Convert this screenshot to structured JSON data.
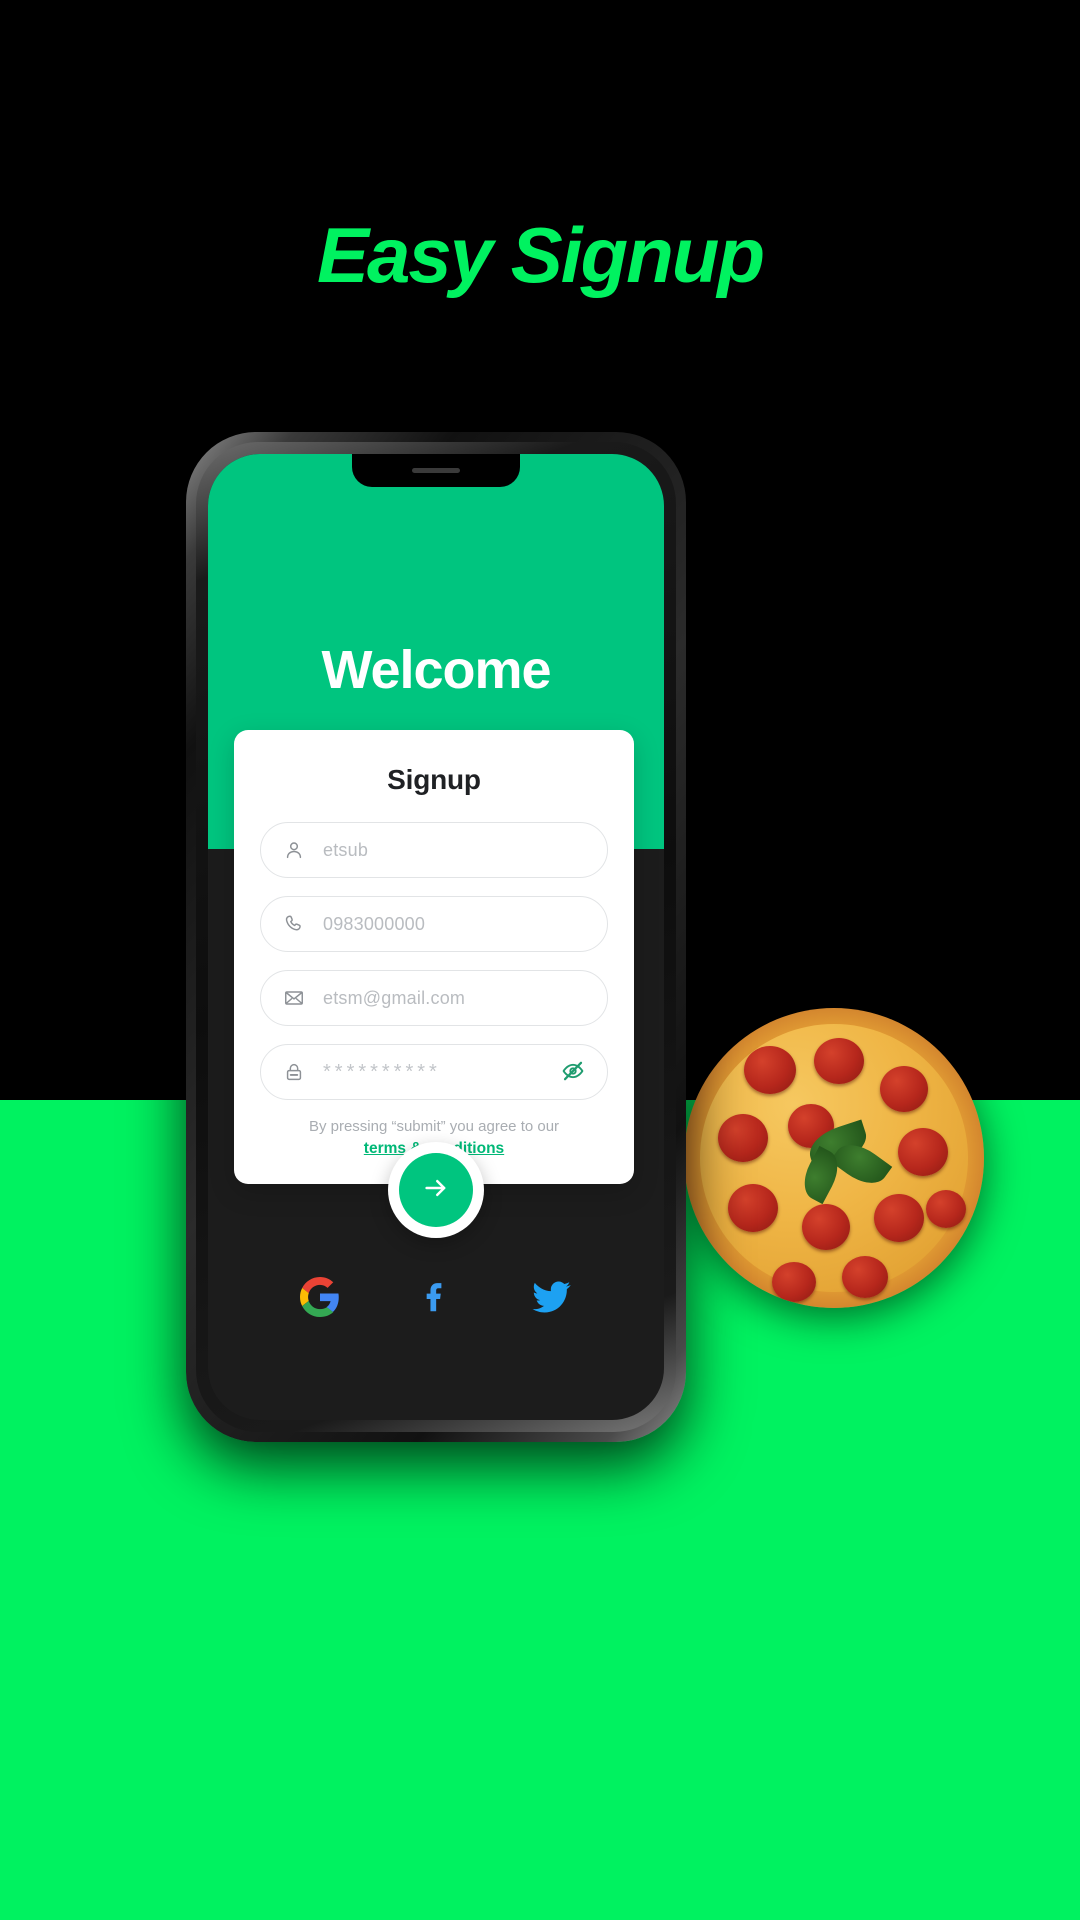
{
  "poster": {
    "headline": "Easy Signup",
    "background_color": "#000000",
    "floor_color": "#00F260",
    "accent_green": "#00C57F"
  },
  "phone": {
    "screen": {
      "hero_title": "Welcome",
      "hero_background": "#00C57F",
      "body_background": "#1C1C1C"
    },
    "card": {
      "title": "Signup",
      "fields": [
        {
          "name": "username",
          "icon": "user-icon",
          "value": "etsub",
          "placeholder": "etsub"
        },
        {
          "name": "phone",
          "icon": "phone-icon",
          "value": "0983000000",
          "placeholder": "0983000000"
        },
        {
          "name": "email",
          "icon": "mail-icon",
          "value": "etsm@gmail.com",
          "placeholder": "etsm@gmail.com"
        },
        {
          "name": "password",
          "icon": "lock-icon",
          "value": "**********",
          "placeholder": "**********",
          "trailing_icon": "eye-off-icon"
        }
      ],
      "terms_text": "By pressing “submit” you agree to our",
      "terms_link": "terms & conditions",
      "terms_link_color": "#00B877"
    },
    "submit": {
      "label": "→",
      "icon": "arrow-right-icon"
    },
    "socials": [
      {
        "name": "google",
        "icon": "google-icon"
      },
      {
        "name": "facebook",
        "icon": "facebook-icon"
      },
      {
        "name": "twitter",
        "icon": "twitter-icon"
      }
    ]
  }
}
